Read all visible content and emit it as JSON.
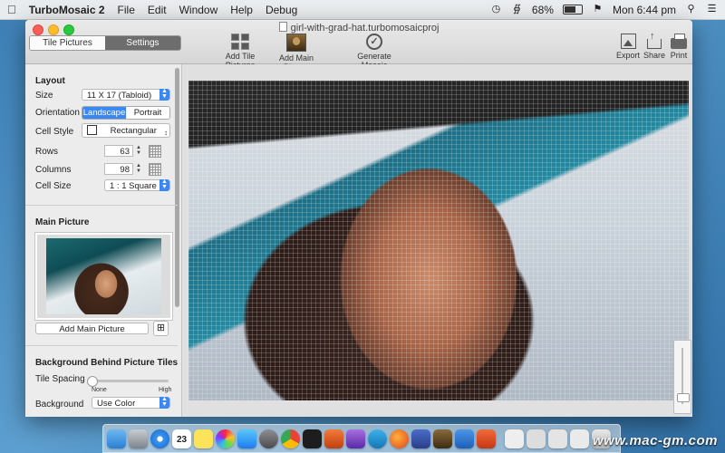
{
  "menubar": {
    "app_name": "TurboMosaic 2",
    "menus": [
      "File",
      "Edit",
      "Window",
      "Help",
      "Debug"
    ],
    "battery_percent": "68%",
    "battery_level": 0.68,
    "clock": "Mon 6:44 pm"
  },
  "window": {
    "title": "girl-with-grad-hat.turbomosaicproj",
    "segment": {
      "tab_tiles": "Tile Pictures",
      "tab_settings": "Settings",
      "selected": "Settings"
    },
    "toolbar": {
      "add_tiles": "Add Tile Pictures",
      "add_main": "Add Main Picture",
      "generate": "Generate Mosaic",
      "export": "Export",
      "share": "Share",
      "print": "Print"
    }
  },
  "layout": {
    "title": "Layout",
    "size_label": "Size",
    "size_value": "11 X 17 (Tabloid)",
    "orientation_label": "Orientation",
    "orientation_options": [
      "Landscape",
      "Portrait"
    ],
    "orientation_selected": "Landscape",
    "cell_style_label": "Cell Style",
    "cell_style_value": "Rectangular",
    "rows_label": "Rows",
    "rows_value": "63",
    "columns_label": "Columns",
    "columns_value": "98",
    "cell_size_label": "Cell Size",
    "cell_size_value": "1 : 1 Square"
  },
  "main_picture": {
    "title": "Main Picture",
    "add_button": "Add Main Picture"
  },
  "background": {
    "title": "Background Behind Picture Tiles",
    "tile_spacing_label": "Tile Spacing",
    "tile_spacing_min": "None",
    "tile_spacing_max": "High",
    "tile_spacing_value": 0.0,
    "background_label": "Background",
    "background_value": "Use Color"
  },
  "zoom_level": 0.1,
  "dock": {
    "calendar_day": "23",
    "watermark": "www.mac-gm.com"
  }
}
